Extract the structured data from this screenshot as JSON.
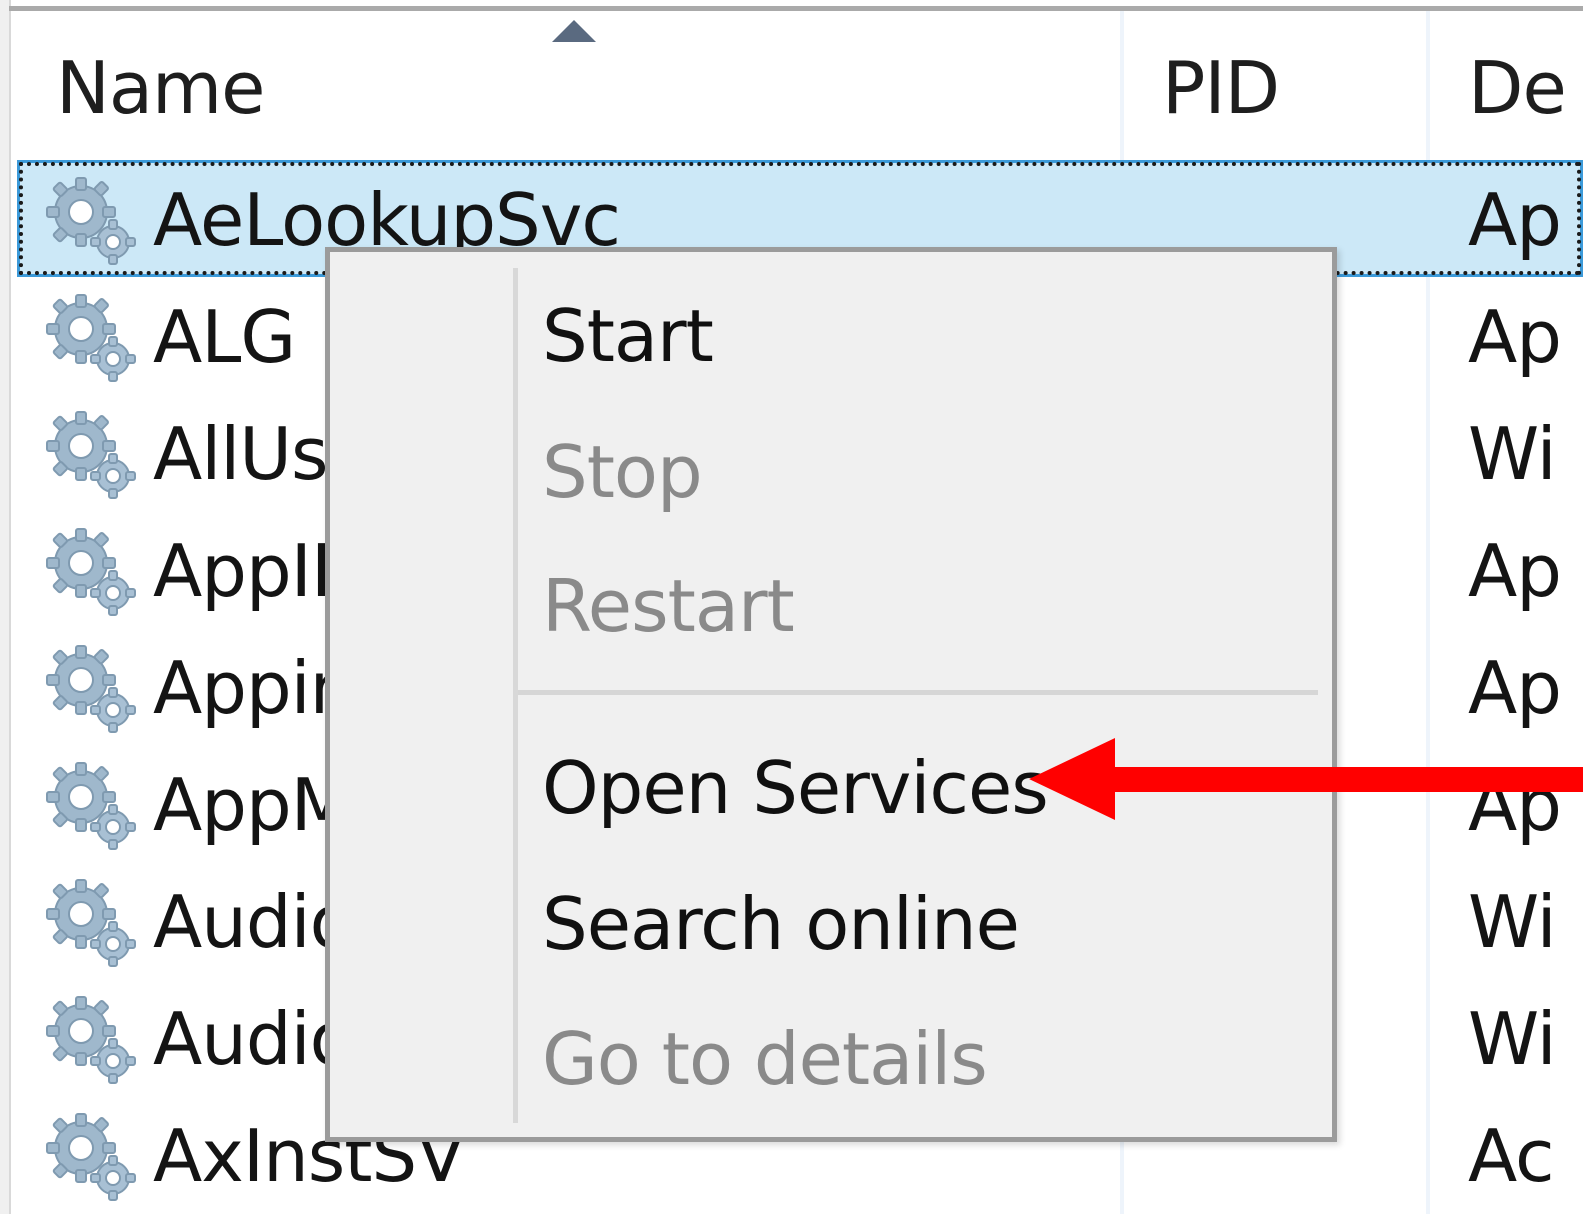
{
  "columns": {
    "name": "Name",
    "pid": "PID",
    "description": "De"
  },
  "rows": [
    {
      "name": "AeLookupSvc",
      "desc": "Ap",
      "selected": true
    },
    {
      "name": "ALG",
      "desc": "Ap"
    },
    {
      "name": "AllUs",
      "desc": "Wi"
    },
    {
      "name": "AppID",
      "desc": "Ap"
    },
    {
      "name": "Appin",
      "desc": "Ap"
    },
    {
      "name": "AppM",
      "desc": "Ap"
    },
    {
      "name": "Audio",
      "desc": "Wi"
    },
    {
      "name": "Audio",
      "desc": "Wi"
    },
    {
      "name": "AxInstSV",
      "desc": "Ac"
    }
  ],
  "context_menu": {
    "start": "Start",
    "stop": "Stop",
    "restart": "Restart",
    "open_services": "Open Services",
    "search_online": "Search online",
    "go_to_details": "Go to details"
  },
  "icons": {
    "service": "gear-icon",
    "sort": "sort-up-icon",
    "annotation": "red-arrow-icon"
  },
  "colors": {
    "selection": "#cce8f7",
    "annotation": "#ff0000",
    "menu_bg": "#f0f0f0",
    "disabled_text": "#8a8a8a"
  }
}
